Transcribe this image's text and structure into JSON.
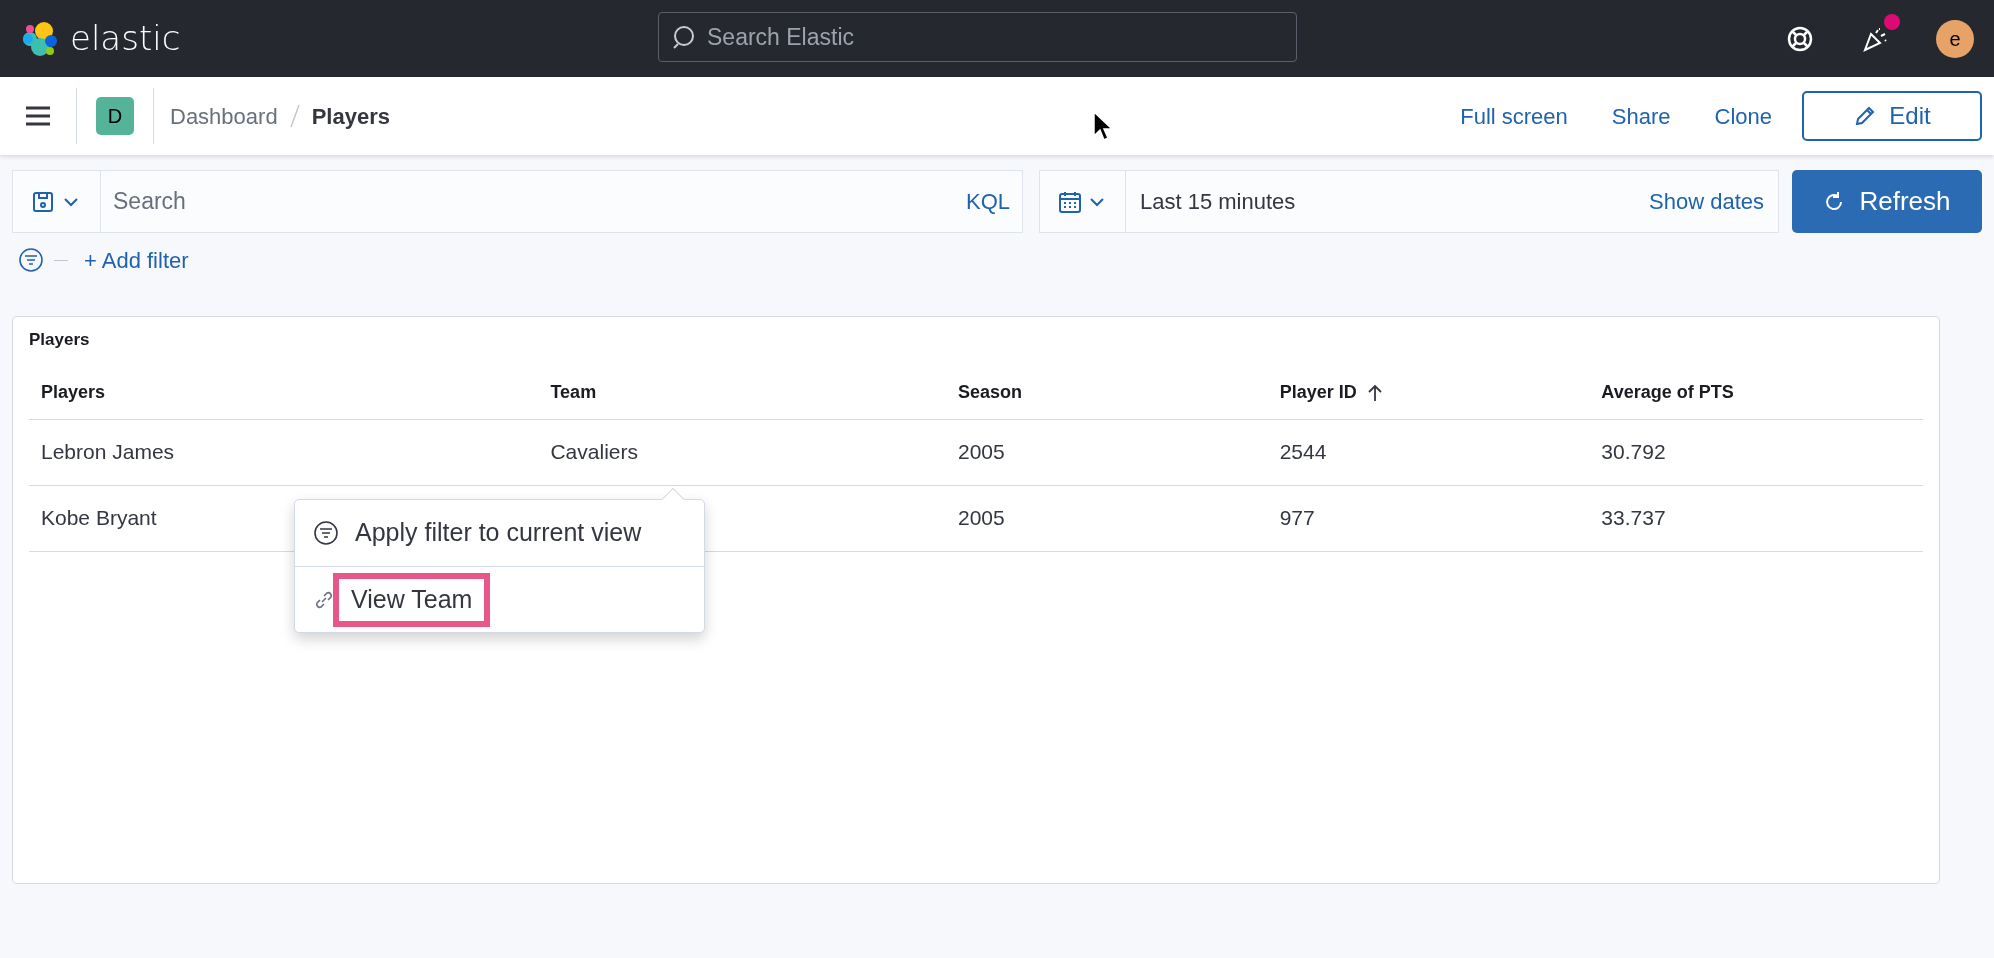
{
  "header": {
    "logo_text": "elastic",
    "search": {
      "placeholder": "Search Elastic"
    },
    "news_badge": true,
    "avatar": "e"
  },
  "nav": {
    "space": "D",
    "breadcrumbs": [
      {
        "label": "Dashboard",
        "selected": false
      },
      {
        "label": "Players",
        "selected": true
      }
    ],
    "links": [
      "Full screen",
      "Share",
      "Clone"
    ],
    "edit_button": "Edit"
  },
  "query": {
    "search": {
      "placeholder": "Search"
    },
    "language": "KQL",
    "time": "Last 15 minutes",
    "show_dates": "Show dates",
    "refresh_button": "Refresh",
    "add_filter": "+ Add filter"
  },
  "panel": {
    "title": "Players",
    "table": {
      "columns": [
        {
          "label": "Players",
          "sorted": false
        },
        {
          "label": "Team",
          "sorted": false
        },
        {
          "label": "Season",
          "sorted": false
        },
        {
          "label": "Player ID",
          "sorted": true
        },
        {
          "label": "Average of PTS",
          "sorted": false
        }
      ],
      "rows": [
        [
          "Lebron James",
          "Cavaliers",
          "2005",
          "2544",
          "30.792"
        ],
        [
          "Kobe Bryant",
          null,
          "2005",
          "977",
          "33.737"
        ]
      ]
    }
  },
  "popover": {
    "items": [
      {
        "kind": "filter",
        "label": "Apply filter to current view",
        "highlighted": false
      },
      {
        "kind": "link",
        "label": "View Team",
        "highlighted": true
      }
    ]
  }
}
